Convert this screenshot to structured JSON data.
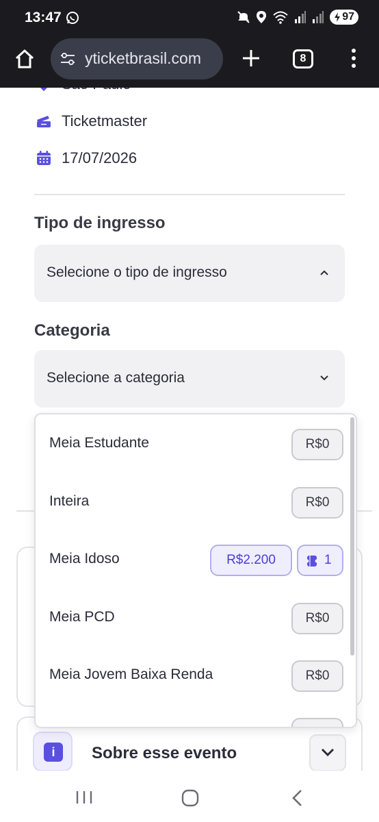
{
  "status_bar": {
    "time": "13:47",
    "battery": "97",
    "icons": [
      "whatsapp-icon",
      "mute-icon",
      "location-icon",
      "wifi-icon",
      "signal-icon",
      "signal-icon",
      "battery-charging-icon"
    ]
  },
  "browser": {
    "url": "yticketbrasil.com",
    "tab_count": "8",
    "icons": [
      "home-icon",
      "site-settings-icon",
      "new-tab-plus-icon",
      "tab-switcher-icon",
      "more-menu-icon"
    ]
  },
  "event_info": {
    "location": "São Paulo",
    "vendor": "Ticketmaster",
    "date": "17/07/2026"
  },
  "form": {
    "ticket_type_label": "Tipo de ingresso",
    "ticket_type_placeholder": "Selecione o tipo de ingresso",
    "category_label": "Categoria",
    "category_placeholder": "Selecione a categoria"
  },
  "dropdown_options": [
    {
      "label": "Meia Estudante",
      "price": "R$0"
    },
    {
      "label": "Inteira",
      "price": "R$0"
    },
    {
      "label": "Meia Idoso",
      "price": "R$2.200",
      "stock": "1"
    },
    {
      "label": "Meia PCD",
      "price": "R$0"
    },
    {
      "label": "Meia Jovem Baixa Renda",
      "price": "R$0"
    }
  ],
  "about": {
    "title": "Sobre esse evento",
    "icon_letter": "i"
  },
  "colors": {
    "accent": "#5a4fe0",
    "dark_bar": "#1b1b1f",
    "url_bar": "#3a3d4a"
  }
}
